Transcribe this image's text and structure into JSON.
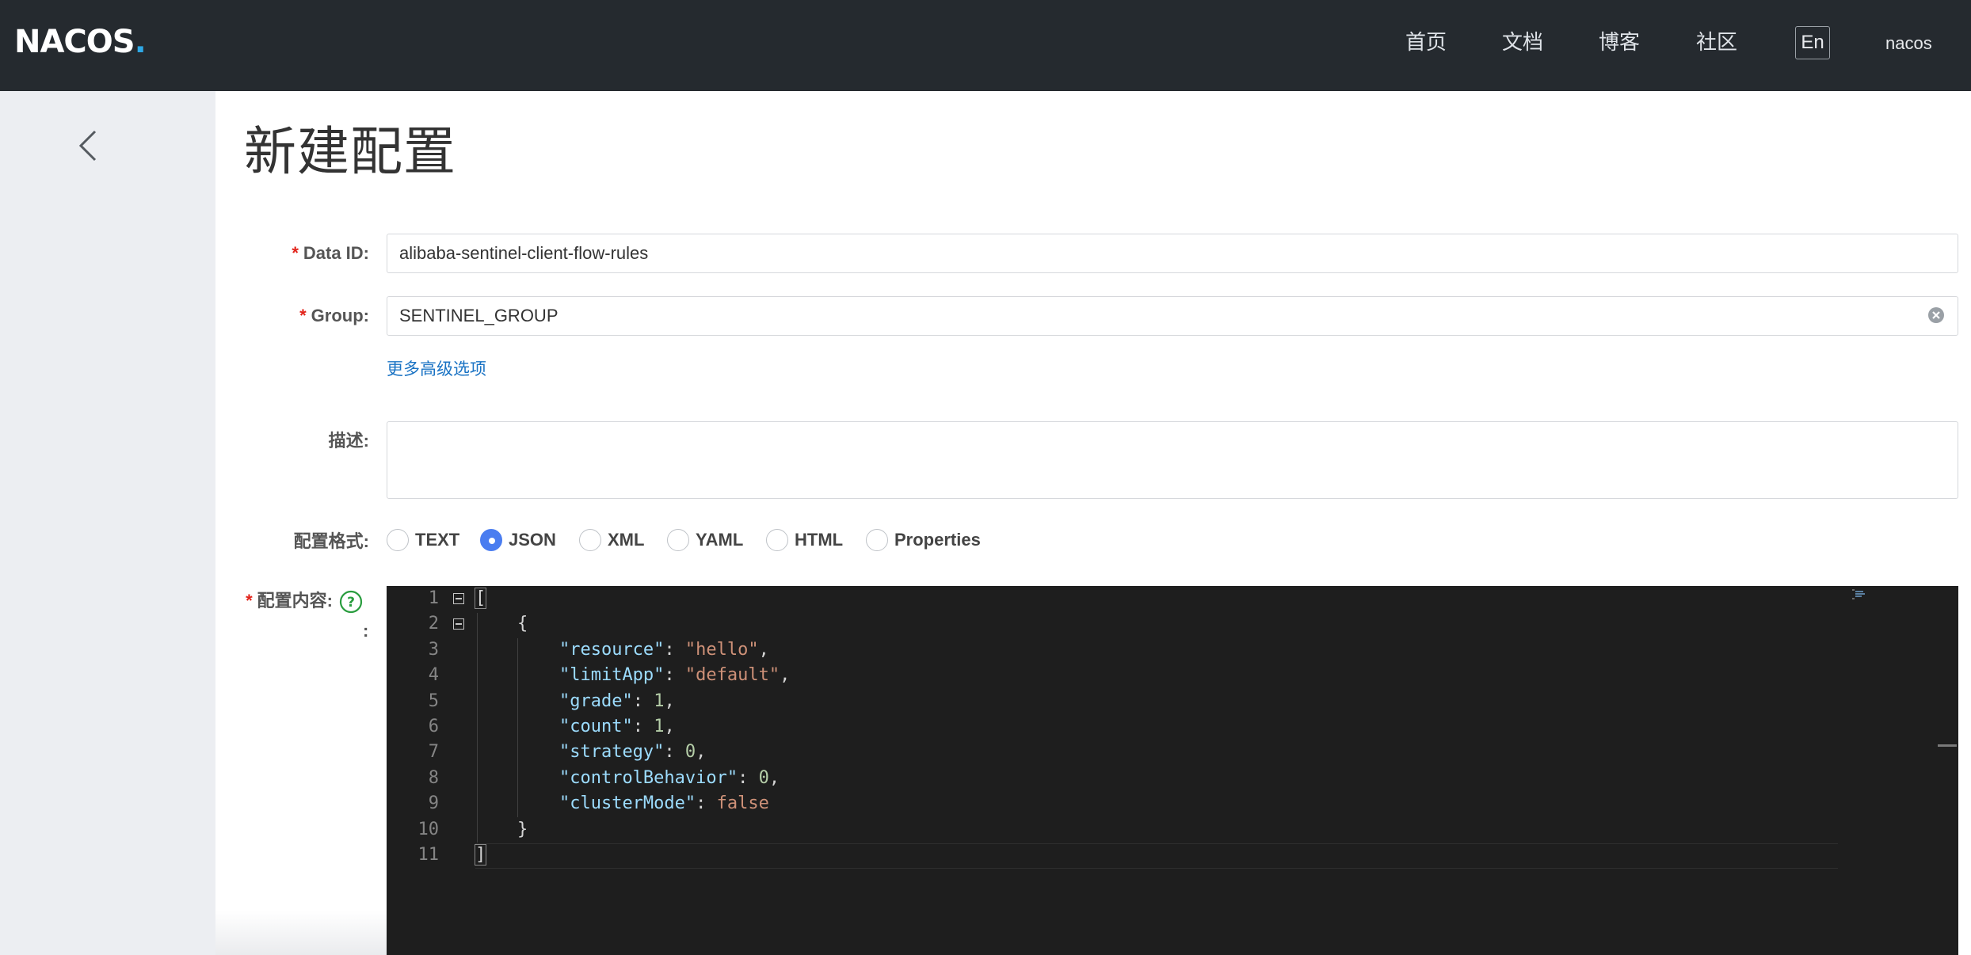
{
  "header": {
    "logo_text": "NACOS",
    "logo_dot": ".",
    "nav": [
      {
        "label": "首页"
      },
      {
        "label": "文档"
      },
      {
        "label": "博客"
      },
      {
        "label": "社区"
      }
    ],
    "lang_button": "En",
    "user": "nacos"
  },
  "page": {
    "title": "新建配置"
  },
  "form": {
    "required_mark": "*",
    "data_id": {
      "label": "Data ID:",
      "value": "alibaba-sentinel-client-flow-rules"
    },
    "group": {
      "label": "Group:",
      "value": "SENTINEL_GROUP"
    },
    "advanced_link": "更多高级选项",
    "description": {
      "label": "描述:",
      "value": ""
    },
    "format": {
      "label": "配置格式:",
      "options": [
        "TEXT",
        "JSON",
        "XML",
        "YAML",
        "HTML",
        "Properties"
      ],
      "selected": "JSON"
    },
    "content": {
      "label": "配置内容:",
      "colon": ":"
    }
  },
  "editor": {
    "line_numbers": [
      "1",
      "2",
      "3",
      "4",
      "5",
      "6",
      "7",
      "8",
      "9",
      "10",
      "11"
    ],
    "lines": [
      "[",
      "    {",
      "        \"resource\": \"hello\",",
      "        \"limitApp\": \"default\",",
      "        \"grade\": 1,",
      "        \"count\": 1,",
      "        \"strategy\": 0,",
      "        \"controlBehavior\": 0,",
      "        \"clusterMode\": false",
      "    }",
      "]"
    ]
  },
  "colors": {
    "topbar": "#252a2f",
    "sidebar": "#eceef2",
    "link": "#1a73c4",
    "radio_checked": "#4a7df0",
    "required": "#e2231a",
    "editor_bg": "#1e1e1e",
    "json_key": "#9cdcfe",
    "json_string": "#ce9178",
    "json_number": "#b5cea8"
  },
  "icons": [
    "back-chevron-icon",
    "clear-circle-icon",
    "help-question-icon",
    "fold-icon"
  ]
}
